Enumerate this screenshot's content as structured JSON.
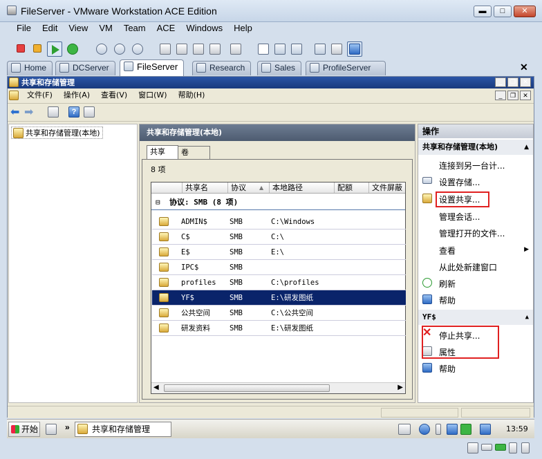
{
  "window": {
    "title": "FileServer - VMware Workstation ACE Edition",
    "min": "▬",
    "max": "□",
    "close": "✕"
  },
  "menu": [
    "File",
    "Edit",
    "View",
    "VM",
    "Team",
    "ACE",
    "Windows",
    "Help"
  ],
  "tabs": [
    "Home",
    "DCServer",
    "FileServer",
    "Research",
    "Sales",
    "ProfileServer"
  ],
  "tab_close": "✕",
  "mmc": {
    "title": "共享和存储管理",
    "menu": [
      "文件(F)",
      "操作(A)",
      "查看(V)",
      "窗口(W)",
      "帮助(H)"
    ],
    "tree_root": "共享和存储管理(本地)",
    "center_header": "共享和存储管理(本地)",
    "subtabs": [
      "共享",
      "卷"
    ],
    "count": "8 项",
    "columns": [
      "共享名",
      "协议",
      "本地路径",
      "配额",
      "文件屏蔽"
    ],
    "group": "协议: SMB (8 项)",
    "group_toggle": "⊟",
    "rows": [
      {
        "name": "ADMIN$",
        "protocol": "SMB",
        "path": "C:\\Windows"
      },
      {
        "name": "C$",
        "protocol": "SMB",
        "path": "C:\\"
      },
      {
        "name": "E$",
        "protocol": "SMB",
        "path": "E:\\"
      },
      {
        "name": "IPC$",
        "protocol": "SMB",
        "path": ""
      },
      {
        "name": "profiles",
        "protocol": "SMB",
        "path": "C:\\profiles"
      },
      {
        "name": "YF$",
        "protocol": "SMB",
        "path": "E:\\研发图纸"
      },
      {
        "name": "公共空间",
        "protocol": "SMB",
        "path": "C:\\公共空间"
      },
      {
        "name": "研发资料",
        "protocol": "SMB",
        "path": "E:\\研发图纸"
      }
    ],
    "actions": {
      "header": "操作",
      "section1": "共享和存储管理(本地)",
      "items1": [
        "连接到另一台计...",
        "设置存储...",
        "设置共享...",
        "管理会话...",
        "管理打开的文件...",
        "查看",
        "从此处新建窗口",
        "刷新",
        "帮助"
      ],
      "section2": "YF$",
      "items2": [
        "停止共享...",
        "属性",
        "帮助"
      ]
    }
  },
  "taskbar": {
    "start": "开始",
    "task": "共享和存储管理",
    "clock": "13:59",
    "chevron": "»"
  },
  "colors": {
    "selection": "#0a246a",
    "highlight_box": "#e02020",
    "titlebar": "#1a3a7d"
  }
}
